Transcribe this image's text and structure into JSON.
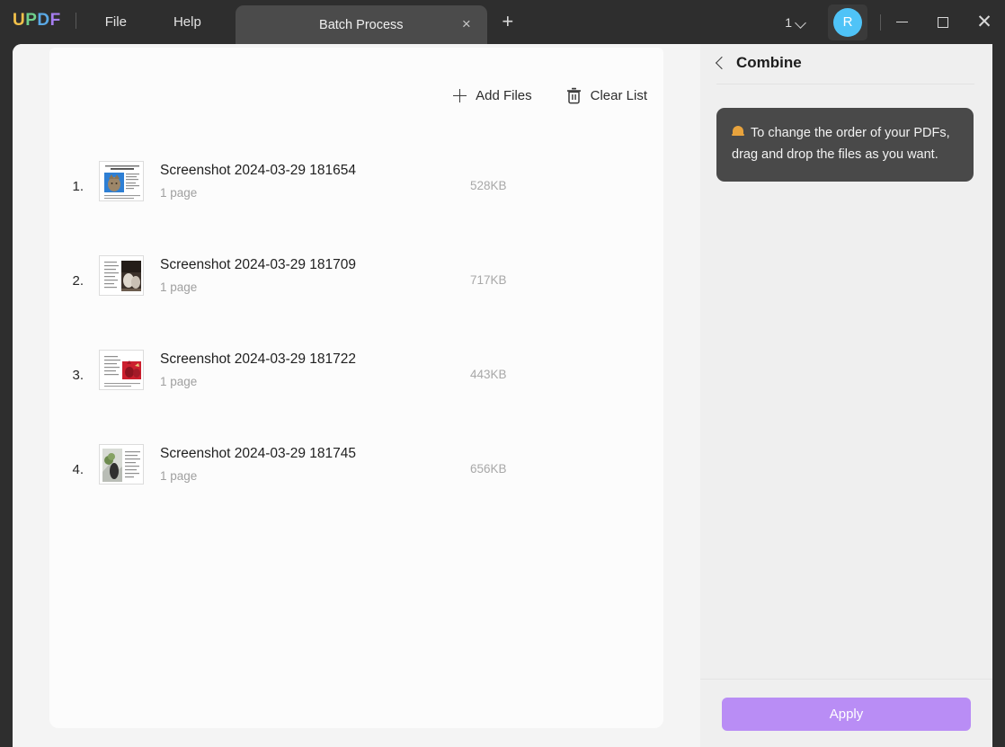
{
  "titlebar": {
    "logo": "UPDF",
    "logo_letters": [
      {
        "ch": "U",
        "color": "#f2c14a"
      },
      {
        "ch": "P",
        "color": "#6fd08c"
      },
      {
        "ch": "D",
        "color": "#5aa9e6"
      },
      {
        "ch": "F",
        "color": "#a67ef0"
      }
    ],
    "menus": [
      {
        "label": "File",
        "name": "menu-file"
      },
      {
        "label": "Help",
        "name": "menu-help"
      }
    ],
    "tab": {
      "label": "Batch Process",
      "close_icon": "close-icon",
      "close_glyph": "×"
    },
    "new_tab_glyph": "+",
    "page_count": "1",
    "avatar_letter": "R",
    "window_controls": {
      "minimize": "minimize-icon",
      "maximize": "maximize-icon",
      "close": "close-icon",
      "close_glyph": "✕"
    }
  },
  "toolbar": {
    "add_files_label": "Add Files",
    "add_files_icon": "plus-icon",
    "clear_list_label": "Clear List",
    "clear_list_icon": "trash-icon"
  },
  "files": [
    {
      "index": "1.",
      "name": "Screenshot 2024-03-29 181654",
      "pages": "1 page",
      "size": "528KB",
      "thumb": {
        "accent": "#2e7fd4",
        "photo_side": "left"
      }
    },
    {
      "index": "2.",
      "name": "Screenshot 2024-03-29 181709",
      "pages": "1 page",
      "size": "717KB",
      "thumb": {
        "accent": "#5a4a40",
        "photo_side": "right"
      }
    },
    {
      "index": "3.",
      "name": "Screenshot 2024-03-29 181722",
      "pages": "1 page",
      "size": "443KB",
      "thumb": {
        "accent": "#cc1f2e",
        "photo_side": "right"
      }
    },
    {
      "index": "4.",
      "name": "Screenshot 2024-03-29 181745",
      "pages": "1 page",
      "size": "656KB",
      "thumb": {
        "accent": "#c9cdc6",
        "photo_side": "left"
      }
    }
  ],
  "right_panel": {
    "back_icon": "chevron-left-icon",
    "title": "Combine",
    "notice": {
      "icon": "bell-icon",
      "text": "To change the order of your PDFs, drag and drop the files as you want."
    },
    "apply_label": "Apply",
    "apply_color": "#b98df5"
  }
}
